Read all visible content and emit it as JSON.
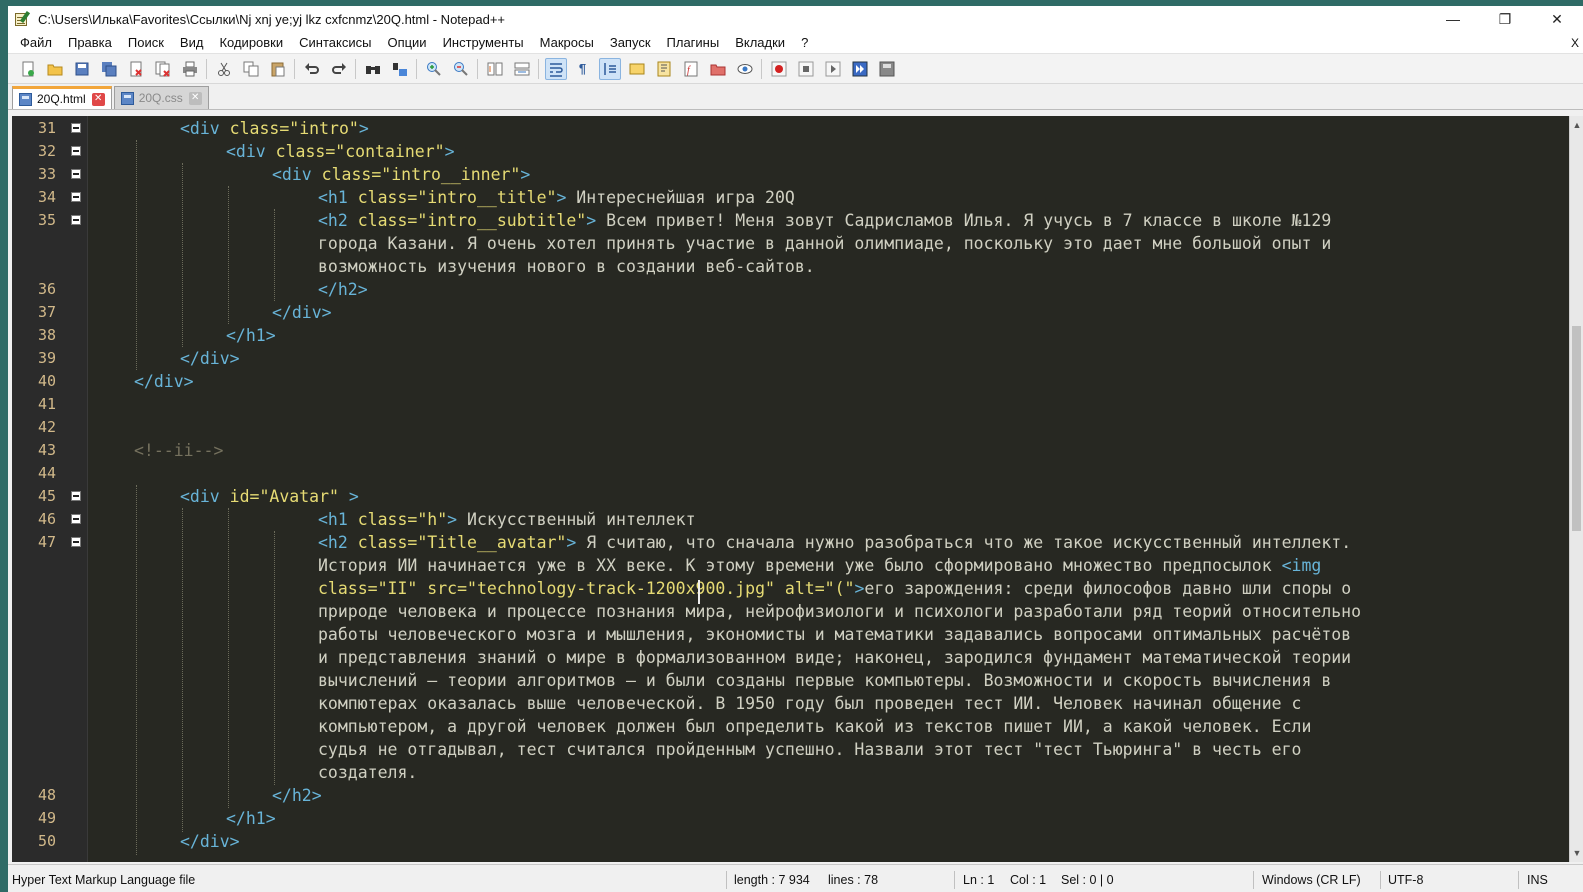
{
  "window": {
    "title": "C:\\Users\\Илька\\Favorites\\Ссылки\\Nj xnj ye;yj lkz cxfcnmz\\20Q.html - Notepad++",
    "minimize": "—",
    "maximize": "❐",
    "close": "✕"
  },
  "menu": {
    "items": [
      "Файл",
      "Правка",
      "Поиск",
      "Вид",
      "Кодировки",
      "Синтаксисы",
      "Опции",
      "Инструменты",
      "Макросы",
      "Запуск",
      "Плагины",
      "Вкладки",
      "?"
    ],
    "close": "X"
  },
  "toolbar": {
    "icons": [
      "new-file-icon",
      "open-file-icon",
      "save-icon",
      "save-all-icon",
      "close-icon",
      "close-all-icon",
      "print-icon",
      "cut-icon",
      "copy-icon",
      "paste-icon",
      "undo-icon",
      "redo-icon",
      "find-icon",
      "replace-icon",
      "zoom-in-icon",
      "zoom-out-icon",
      "sync-vertical-icon",
      "sync-horizontal-icon",
      "word-wrap-icon",
      "show-all-chars-icon",
      "indent-guide-icon",
      "user-language-icon",
      "document-map-icon",
      "function-list-icon",
      "folder-workspace-icon",
      "monitoring-icon",
      "record-macro-icon",
      "stop-record-icon",
      "play-macro-icon",
      "run-macro-multiple-icon",
      "save-macro-icon"
    ]
  },
  "tabs": [
    {
      "label": "20Q.html",
      "active": true
    },
    {
      "label": "20Q.css",
      "active": false
    }
  ],
  "colors": {
    "editor_bg": "#272822",
    "tag": "#68b4d8",
    "attribute": "#e6db74",
    "text": "#d0d0c2",
    "comment": "#75715e",
    "line_number": "#d2b98a"
  },
  "editor": {
    "line_numbers": [
      "31",
      "32",
      "33",
      "34",
      "35",
      "36",
      "37",
      "38",
      "39",
      "40",
      "41",
      "42",
      "43",
      "44",
      "45",
      "46",
      "47",
      "48",
      "49",
      "50"
    ],
    "lines": {
      "l31": {
        "tag": "<div",
        "attr": " class=",
        "val": "\"intro\"",
        "tag2": ">"
      },
      "l32": {
        "tag": "<div",
        "attr": " class=",
        "val": "\"container\"",
        "tag2": ">"
      },
      "l33": {
        "tag": "<div",
        "attr": " class=",
        "val": "\"intro__inner\"",
        "tag2": ">"
      },
      "l34": {
        "tag": "<h1",
        "attr": " class=",
        "val": "\"intro__title\"",
        "tag2": ">",
        "text": " Интереснейшая игра 20Q"
      },
      "l35": {
        "tag": "<h2",
        "attr": " class=",
        "val": "\"intro__subtitle\"",
        "tag2": ">",
        "text": " Всем привет! Меня зовут Садрисламов Илья. Я учусь в 7 классе в школе №129"
      },
      "l35b": "города Казани. Я очень хотел принять участие в данной олимпиаде, поскольку это дает мне большой опыт и",
      "l35c": "возможность изучения нового в создании веб-сайтов.",
      "l36": "</h2>",
      "l37": "</div>",
      "l38": "</h1>",
      "l39": "</div>",
      "l40": "</div>",
      "l43": "<!--ii-->",
      "l45": {
        "tag": "<div",
        "attr": " id=",
        "val": "\"Avatar\"",
        "tag2": " >"
      },
      "l46": {
        "tag": "<h1",
        "attr": " class=",
        "val": "\"h\"",
        "tag2": ">",
        "text": " Искусственный интеллект"
      },
      "l47": {
        "tag": "<h2",
        "attr": " class=",
        "val": "\"Title__avatar\"",
        "tag2": ">",
        "text": " Я считаю, что сначала нужно разобраться что же такое искусственный интеллект."
      },
      "l47b": {
        "text": "История ИИ начинается уже в XX веке. К этому времени уже было сформировано множество предпосылок ",
        "tag": "<img"
      },
      "l47c": {
        "attr": "class=",
        "val": "\"II\"",
        "attr2": " src=",
        "val2": "\"technology-track-1200x900.jpg\"",
        "attr3": " alt=",
        "val3": "\"(\"",
        "tag": ">",
        "text": "его зарождения: среди философов давно шли споры о"
      },
      "l47d": "природе человека и процессе познания мира, нейрофизиологи и психологи разработали ряд теорий относительно",
      "l47e": "работы человеческого мозга и мышления, экономисты и математики задавались вопросами оптимальных расчётов",
      "l47f": "и представления знаний о мире в формализованном виде; наконец, зародился фундамент математической теории",
      "l47g": "вычислений — теории алгоритмов — и были созданы первые компьютеры. Возможности и скорость вычисления в",
      "l47h": "компютерах оказалась выше человеческой. В 1950 году был проведен тест ИИ. Человек начинал общение с",
      "l47i": "компьютером, а другой человек должен был определить какой из текстов пишет ИИ, а какой человек. Если",
      "l47j": "судья не отгадывал, тест считался пройденным успешно. Назвали этот тест \"тест Тьюринга\" в честь его",
      "l47k": "создателя.",
      "l48": "</h2>",
      "l49": "</h1>",
      "l50": "</div>"
    }
  },
  "status": {
    "file_type": "Hyper Text Markup Language file",
    "length": "length : 7 934",
    "lines": "lines : 78",
    "ln": "Ln : 1",
    "col": "Col : 1",
    "sel": "Sel : 0 | 0",
    "eol": "Windows (CR LF)",
    "encoding": "UTF-8",
    "mode": "INS"
  }
}
